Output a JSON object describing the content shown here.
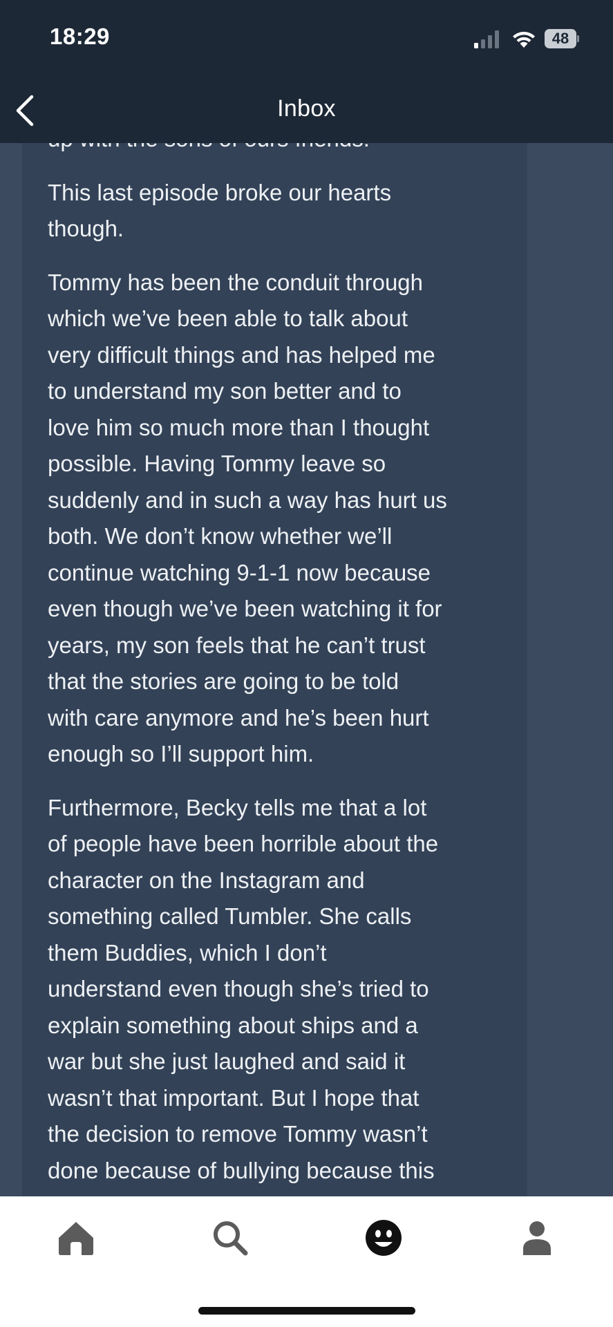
{
  "status_bar": {
    "time": "18:29",
    "battery_level": "48",
    "icons": [
      "cellular-signal-icon",
      "wifi-icon",
      "battery-icon"
    ]
  },
  "header": {
    "title": "Inbox",
    "back_icon": "chevron-left-icon"
  },
  "message": {
    "paragraphs": [
      [
        "up with the sons of ours friends."
      ],
      [
        "This last episode broke our hearts",
        "though."
      ],
      [
        "Tommy has been the conduit through",
        "which we’ve been able to talk about",
        "very difficult things and has helped me",
        "to understand my son better and to",
        "love him so much more than I thought",
        "possible. Having Tommy leave so",
        "suddenly and in such a way has hurt us",
        "both. We don’t know whether we’ll",
        "continue watching 9-1-1 now because",
        "even though we’ve been watching it for",
        "years, my son feels that he can’t trust",
        "that the stories are going to be told",
        "with care anymore and he’s been hurt",
        "enough so I’ll support him."
      ],
      [
        "Furthermore, Becky tells me that a lot",
        "of people have been horrible about the",
        "character on the Instagram and",
        "something called Tumbler. She calls",
        "them Buddies, which I don’t",
        "understand even though she’s tried to",
        "explain something about ships and a",
        "war but she just laughed and said it",
        "wasn’t that important. But I hope that",
        "the decision to remove Tommy wasn’t",
        "done because of bullying because this"
      ]
    ]
  },
  "bottom_nav": {
    "tabs": [
      {
        "name": "home",
        "icon": "home-icon"
      },
      {
        "name": "search",
        "icon": "search-icon"
      },
      {
        "name": "activity",
        "icon": "smiley-face-icon"
      },
      {
        "name": "account",
        "icon": "person-icon"
      }
    ]
  },
  "colors": {
    "status_bar_bg": "#1d2836",
    "content_bg": "#3b4a5f",
    "card_bg": "#334257",
    "text": "#eef1f4",
    "nav_bar_bg": "#ffffff",
    "nav_icon": "#5b5b5b"
  }
}
